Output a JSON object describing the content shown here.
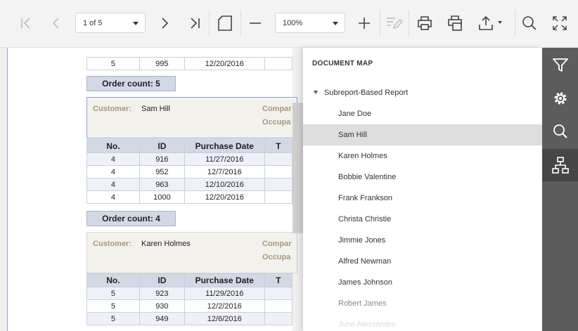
{
  "toolbar": {
    "page_selector": "1 of 5",
    "zoom_selector": "100%"
  },
  "report": {
    "top_row": {
      "no": "5",
      "id": "995",
      "date": "12/20/2016"
    },
    "groups": [
      {
        "order_count": "Order count: 5"
      },
      {
        "customer_label": "Customer:",
        "customer_name": "Sam Hill",
        "company_label": "Compar",
        "occupation_label": "Occupa",
        "headers": [
          "No.",
          "ID",
          "Purchase Date",
          "T"
        ],
        "rows": [
          {
            "no": "4",
            "id": "916",
            "date": "11/27/2016"
          },
          {
            "no": "4",
            "id": "952",
            "date": "12/7/2016"
          },
          {
            "no": "4",
            "id": "963",
            "date": "12/10/2016"
          },
          {
            "no": "4",
            "id": "1000",
            "date": "12/20/2016"
          }
        ],
        "order_count": "Order count: 4"
      },
      {
        "customer_label": "Customer:",
        "customer_name": "Karen Holmes",
        "company_label": "Compar",
        "occupation_label": "Occupa",
        "headers": [
          "No.",
          "ID",
          "Purchase Date",
          "T"
        ],
        "rows": [
          {
            "no": "5",
            "id": "923",
            "date": "11/29/2016"
          },
          {
            "no": "5",
            "id": "930",
            "date": "12/2/2016"
          },
          {
            "no": "5",
            "id": "949",
            "date": "12/6/2016"
          }
        ]
      }
    ]
  },
  "document_map": {
    "title": "DOCUMENT MAP",
    "root": "Subreport-Based Report",
    "items": [
      "Jane Doe",
      "Sam Hill",
      "Karen Holmes",
      "Bobbie Valentine",
      "Frank Frankson",
      "Christa Christie",
      "Jimmie Jones",
      "Alfred Newman",
      "James Johnson",
      "Robert James",
      "June Alessandro"
    ],
    "selected": "Sam Hill"
  }
}
